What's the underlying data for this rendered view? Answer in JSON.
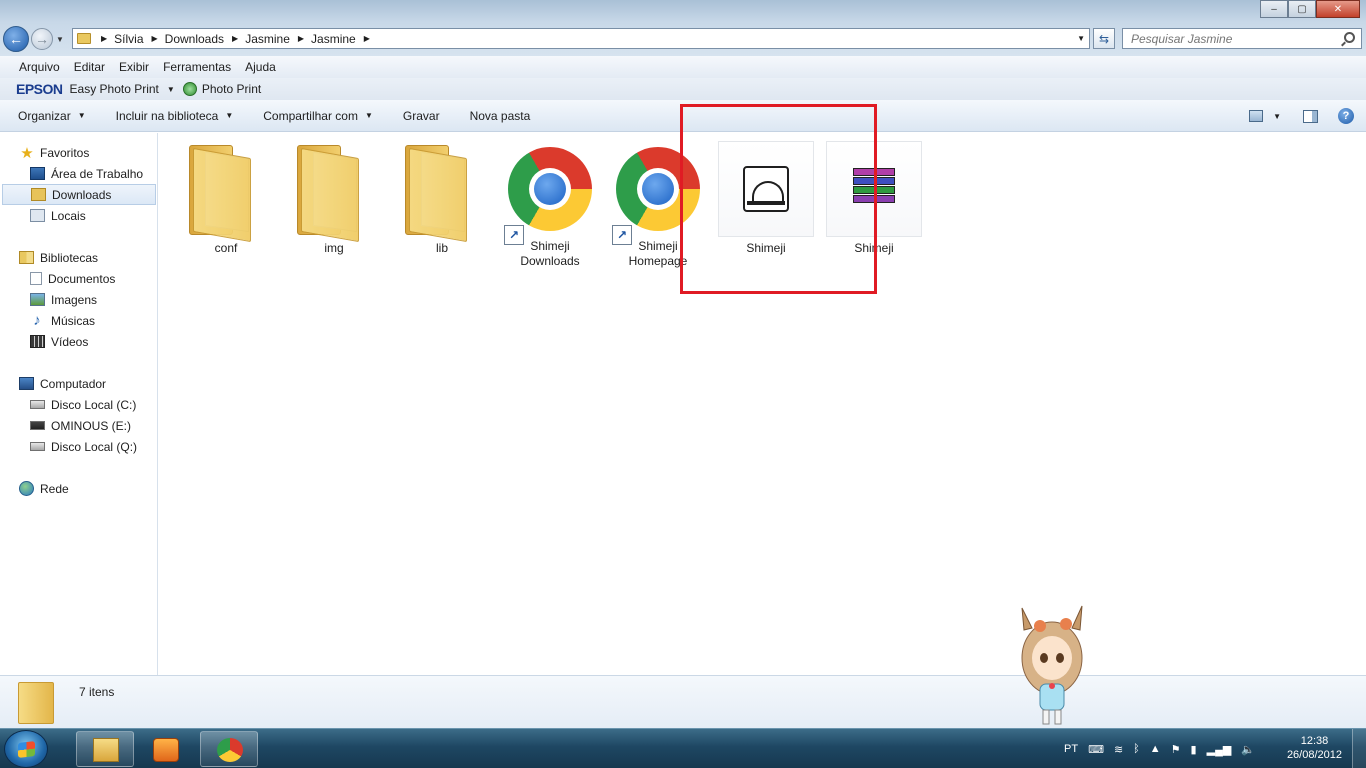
{
  "window": {
    "controls": {
      "minimize": "‒",
      "maximize": "▢",
      "close": "✕"
    }
  },
  "address_bar": {
    "breadcrumbs": [
      "Sílvia",
      "Downloads",
      "Jasmine",
      "Jasmine"
    ],
    "search_placeholder": "Pesquisar Jasmine"
  },
  "menu": [
    "Arquivo",
    "Editar",
    "Exibir",
    "Ferramentas",
    "Ajuda"
  ],
  "epson_toolbar": {
    "logo": "EPSON",
    "easy_photo_print": "Easy Photo Print",
    "photo_print": "Photo Print"
  },
  "command_bar": {
    "organize": "Organizar",
    "include_library": "Incluir na biblioteca",
    "share_with": "Compartilhar com",
    "burn": "Gravar",
    "new_folder": "Nova pasta"
  },
  "sidebar": {
    "favorites": {
      "label": "Favoritos",
      "items": [
        "Área de Trabalho",
        "Downloads",
        "Locais"
      ]
    },
    "libraries": {
      "label": "Bibliotecas",
      "items": [
        "Documentos",
        "Imagens",
        "Músicas",
        "Vídeos"
      ]
    },
    "computer": {
      "label": "Computador",
      "items": [
        "Disco Local (C:)",
        "OMINOUS (E:)",
        "Disco Local (Q:)"
      ]
    },
    "network": {
      "label": "Rede"
    },
    "selected": "Downloads"
  },
  "files": [
    {
      "name": "conf",
      "type": "folder"
    },
    {
      "name": "img",
      "type": "folder"
    },
    {
      "name": "lib",
      "type": "folder"
    },
    {
      "name": "Shimeji Downloads",
      "type": "chrome-shortcut"
    },
    {
      "name": "Shimeji Homepage",
      "type": "chrome-shortcut"
    },
    {
      "name": "Shimeji",
      "type": "application"
    },
    {
      "name": "Shimeji",
      "type": "rar-archive"
    }
  ],
  "status": {
    "item_count": "7 itens"
  },
  "taskbar": {
    "language": "PT",
    "time": "12:38",
    "date": "26/08/2012"
  },
  "colors": {
    "highlight_box": "#e01b24",
    "selected_item": "#dce8f6",
    "epson_blue": "#1a3c8e"
  }
}
